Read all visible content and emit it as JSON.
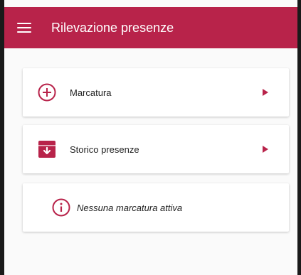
{
  "header": {
    "title": "Rilevazione presenze"
  },
  "menu": [
    {
      "label": "Marcatura",
      "icon": "plus-circle-icon"
    },
    {
      "label": "Storico presenze",
      "icon": "archive-box-icon"
    }
  ],
  "status": {
    "message": "Nessuna marcatura attiva",
    "icon": "info-circle-icon"
  },
  "colors": {
    "accent": "#b8234a",
    "text": "#222222",
    "background": "#fafafa"
  }
}
